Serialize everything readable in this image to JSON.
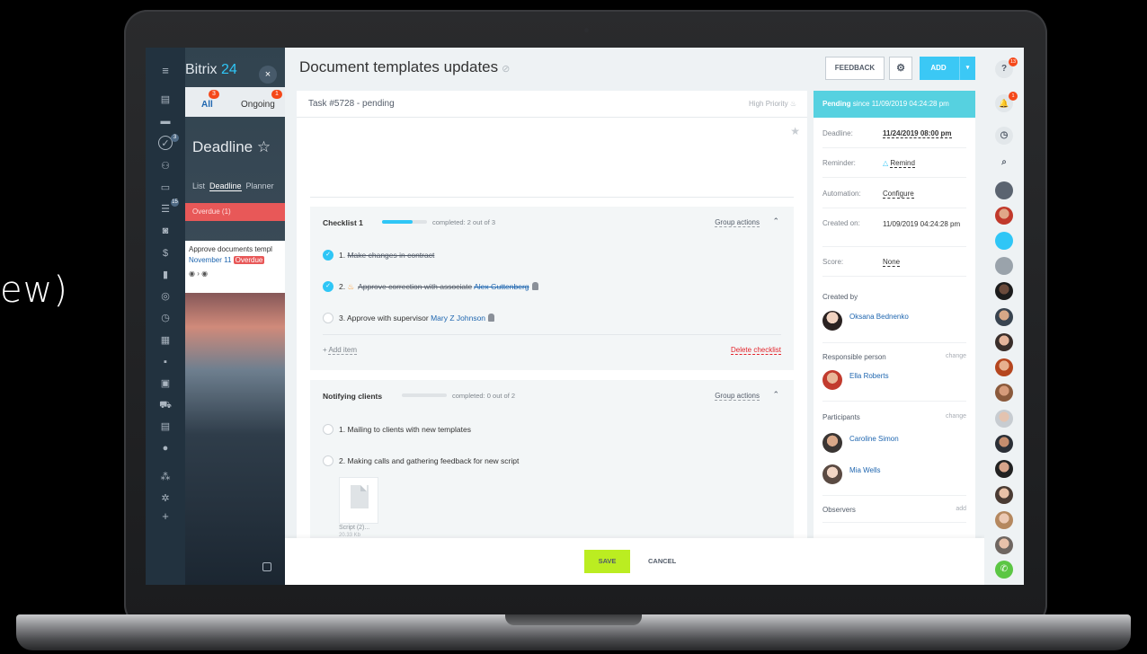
{
  "background_text": "ew)",
  "app": {
    "logo_main": "Bitrix",
    "logo_num": "24",
    "close_glyph": "×",
    "nav_icons": [
      "menu-icon",
      "feed-icon",
      "chat-icon",
      "tasks-icon",
      "employees-icon",
      "calendar-icon",
      "filter-icon",
      "drive-icon",
      "crm-icon",
      "analytics-icon",
      "sites-icon",
      "time-icon",
      "contact-center-icon",
      "apps-icon",
      "store-icon",
      "shop-icon",
      "calendar-icon-2",
      "marketing-icon",
      "automation-icon",
      "settings-icon",
      "add-icon"
    ],
    "nav_badge_tasks": "3",
    "nav_badge_filter": "15"
  },
  "bgpage": {
    "tab_all": "All",
    "tab_all_count": "3",
    "tab_ongoing": "Ongoing",
    "tab_ongoing_count": "1",
    "heading": "Deadline ☆",
    "views": [
      "List",
      "Deadline",
      "Planner"
    ],
    "overdue_label": "Overdue",
    "overdue_count": "(1)",
    "card_title": "Approve documents templ",
    "card_date": "November 11",
    "card_overdue": "Overdue"
  },
  "task": {
    "title": "Document templates updates",
    "link_glyph": "⊘",
    "header_line": "Task #5728 - pending",
    "priority": "High Priority",
    "priority_icon": "flame-icon",
    "star_glyph": "★"
  },
  "header_buttons": {
    "feedback": "FEEDBACK",
    "settings_glyph": "⚙",
    "add": "ADD",
    "add_caret": "▾"
  },
  "checklists": [
    {
      "name": "Checklist 1",
      "progress_fraction": 0.67,
      "completed_text": "completed: 2 out of 3",
      "group_actions": "Group actions",
      "items": [
        {
          "num": "1.",
          "text": "Make changes in contract",
          "done": true
        },
        {
          "num": "2.",
          "text": "Approve correction with associate",
          "user": "Alex Guttenberg",
          "done": true
        },
        {
          "num": "3.",
          "text": "Approve with supervisor",
          "user": "Mary Z Johnson",
          "done": false
        }
      ],
      "add_item": "Add item",
      "delete": "Delete checklist"
    },
    {
      "name": "Notifying clients",
      "progress_fraction": 0,
      "completed_text": "completed: 0 out of 2",
      "group_actions": "Group actions",
      "items": [
        {
          "num": "1.",
          "text": "Mailing to clients with new templates",
          "done": false
        },
        {
          "num": "2.",
          "text": "Making calls and gathering feedback for new script",
          "done": false
        }
      ],
      "file_name": "Script (2)...",
      "file_size": "20.33 Kb"
    }
  ],
  "info": {
    "status_bold": "Pending",
    "status_rest": "since 11/09/2019 04:24:28 pm",
    "deadline_label": "Deadline:",
    "deadline_value": "11/24/2019 08:00 pm",
    "reminder_label": "Reminder:",
    "reminder_value": "Remind",
    "automation_label": "Automation:",
    "automation_value": "Configure",
    "created_label": "Created on:",
    "created_value": "11/09/2019 04:24:28 pm",
    "score_label": "Score:",
    "score_value": "None",
    "created_by_label": "Created by",
    "created_by": "Oksana Bednenko",
    "responsible_label": "Responsible person",
    "responsible_action": "change",
    "responsible": "Ella Roberts",
    "participants_label": "Participants",
    "participants_action": "change",
    "participants": [
      "Caroline Simon",
      "Mia Wells"
    ],
    "observers_label": "Observers",
    "observers_action": "add"
  },
  "footer": {
    "save": "SAVE",
    "cancel": "CANCEL"
  },
  "rightcol": {
    "help_glyph": "?",
    "help_badge": "13",
    "bell_glyph": "🔔",
    "bell_badge": "1",
    "clock_glyph": "◷",
    "search_glyph": "⌕",
    "phone_glyph": "✆"
  },
  "colors": {
    "accent": "#2fc6f6",
    "save": "#bbed21",
    "status": "#56d1e0",
    "danger": "#e3242b"
  }
}
